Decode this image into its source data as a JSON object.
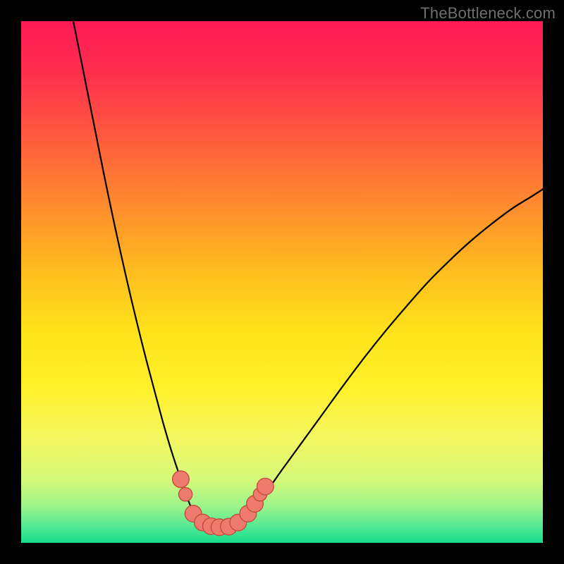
{
  "watermark": "TheBottleneck.com",
  "colors": {
    "frame": "#000000",
    "curve": "#000000",
    "marker_fill": "#ee7b6e",
    "marker_stroke": "#c24a3a",
    "gradient_stops": [
      {
        "offset": 0.0,
        "color": "#ff1a55"
      },
      {
        "offset": 0.1,
        "color": "#ff2f4e"
      },
      {
        "offset": 0.22,
        "color": "#ff5a3e"
      },
      {
        "offset": 0.35,
        "color": "#ff8a2e"
      },
      {
        "offset": 0.48,
        "color": "#ffbd1e"
      },
      {
        "offset": 0.6,
        "color": "#ffe41a"
      },
      {
        "offset": 0.7,
        "color": "#fff028"
      },
      {
        "offset": 0.8,
        "color": "#f4f760"
      },
      {
        "offset": 0.88,
        "color": "#d4f97a"
      },
      {
        "offset": 0.93,
        "color": "#9cf58b"
      },
      {
        "offset": 0.97,
        "color": "#4fe892"
      },
      {
        "offset": 1.0,
        "color": "#17db8e"
      }
    ]
  },
  "chart_data": {
    "type": "line",
    "title": "",
    "xlabel": "",
    "ylabel": "",
    "xlim": [
      0,
      100
    ],
    "ylim": [
      0,
      100
    ],
    "grid": false,
    "legend": false,
    "annotations": [],
    "series": [
      {
        "name": "bottleneck-curve",
        "x": [
          10,
          12,
          14,
          16,
          18,
          20,
          22,
          24,
          26,
          27.5,
          29,
          30.5,
          31.5,
          32.5,
          33.5,
          34.5,
          35.5,
          37,
          38.5,
          40,
          42,
          44,
          47,
          50,
          54,
          58,
          62,
          66,
          70,
          74,
          78,
          82,
          86,
          90,
          94,
          98,
          100
        ],
        "y": [
          100,
          90,
          80,
          70,
          60.5,
          51.5,
          43,
          35,
          27.5,
          22,
          17,
          12.5,
          9.5,
          7,
          5,
          3.8,
          3.2,
          3.0,
          3.0,
          3.2,
          4.3,
          6.2,
          9.8,
          14,
          19.5,
          25,
          30.5,
          35.8,
          40.8,
          45.5,
          50,
          54,
          57.7,
          61,
          64,
          66.5,
          67.8
        ]
      }
    ],
    "markers": [
      {
        "x": 30.6,
        "y": 12.2,
        "r": 1.6
      },
      {
        "x": 31.5,
        "y": 9.3,
        "r": 1.3
      },
      {
        "x": 33.0,
        "y": 5.6,
        "r": 1.6
      },
      {
        "x": 34.8,
        "y": 3.9,
        "r": 1.6
      },
      {
        "x": 36.4,
        "y": 3.2,
        "r": 1.6
      },
      {
        "x": 38.0,
        "y": 3.0,
        "r": 1.6
      },
      {
        "x": 39.8,
        "y": 3.1,
        "r": 1.6
      },
      {
        "x": 41.6,
        "y": 3.9,
        "r": 1.6
      },
      {
        "x": 43.5,
        "y": 5.6,
        "r": 1.6
      },
      {
        "x": 44.8,
        "y": 7.5,
        "r": 1.6
      },
      {
        "x": 45.8,
        "y": 9.3,
        "r": 1.3
      },
      {
        "x": 46.8,
        "y": 10.8,
        "r": 1.6
      }
    ]
  }
}
